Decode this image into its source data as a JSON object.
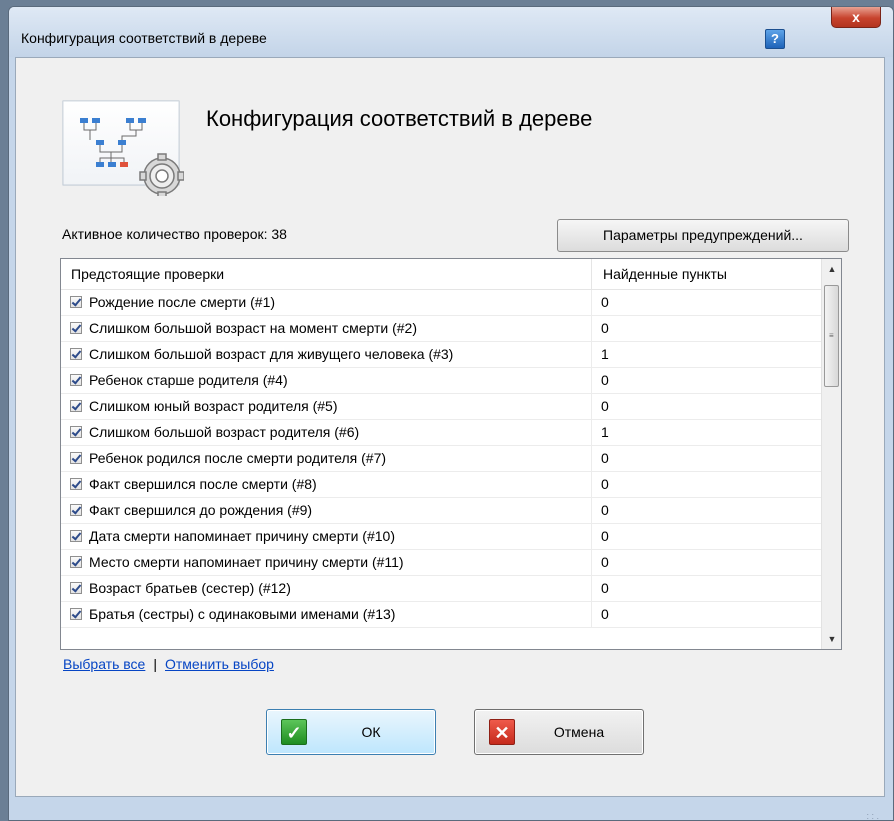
{
  "window": {
    "title": "Конфигурация соответствий в дереве",
    "help_label": "?",
    "close_label": "x"
  },
  "header": {
    "heading": "Конфигурация соответствий в дереве",
    "icon": "tree-settings-icon"
  },
  "active_count": "Активное количество проверок: 38",
  "warnings_button": "Параметры предупреждений...",
  "list": {
    "columns": [
      "Предстоящие проверки",
      "Найденные пункты"
    ],
    "rows": [
      {
        "name": "Рождение после смерти (#1)",
        "found": "0",
        "checked": true
      },
      {
        "name": "Слишком большой возраст на момент смерти (#2)",
        "found": "0",
        "checked": true
      },
      {
        "name": "Слишком большой возраст для живущего человека (#3)",
        "found": "1",
        "checked": true
      },
      {
        "name": "Ребенок старше родителя (#4)",
        "found": "0",
        "checked": true
      },
      {
        "name": "Слишком юный возраст родителя (#5)",
        "found": "0",
        "checked": true
      },
      {
        "name": "Слишком большой возраст родителя (#6)",
        "found": "1",
        "checked": true
      },
      {
        "name": "Ребенок родился после смерти родителя (#7)",
        "found": "0",
        "checked": true
      },
      {
        "name": "Факт свершился после смерти (#8)",
        "found": "0",
        "checked": true
      },
      {
        "name": "Факт свершился до рождения (#9)",
        "found": "0",
        "checked": true
      },
      {
        "name": "Дата смерти напоминает причину смерти (#10)",
        "found": "0",
        "checked": true
      },
      {
        "name": "Место смерти напоминает причину смерти (#11)",
        "found": "0",
        "checked": true
      },
      {
        "name": "Возраст братьев (сестер) (#12)",
        "found": "0",
        "checked": true
      },
      {
        "name": "Братья (сестры) с одинаковыми именами (#13)",
        "found": "0",
        "checked": true
      }
    ]
  },
  "links": {
    "select_all": "Выбрать все",
    "separator": "|",
    "deselect": "Отменить выбор"
  },
  "buttons": {
    "ok": "ОК",
    "cancel": "Отмена"
  },
  "colors": {
    "link": "#0645c4",
    "ok_icon": "#2e9b30",
    "cancel_icon": "#d33a2c",
    "frame": "#c5d6ea"
  }
}
